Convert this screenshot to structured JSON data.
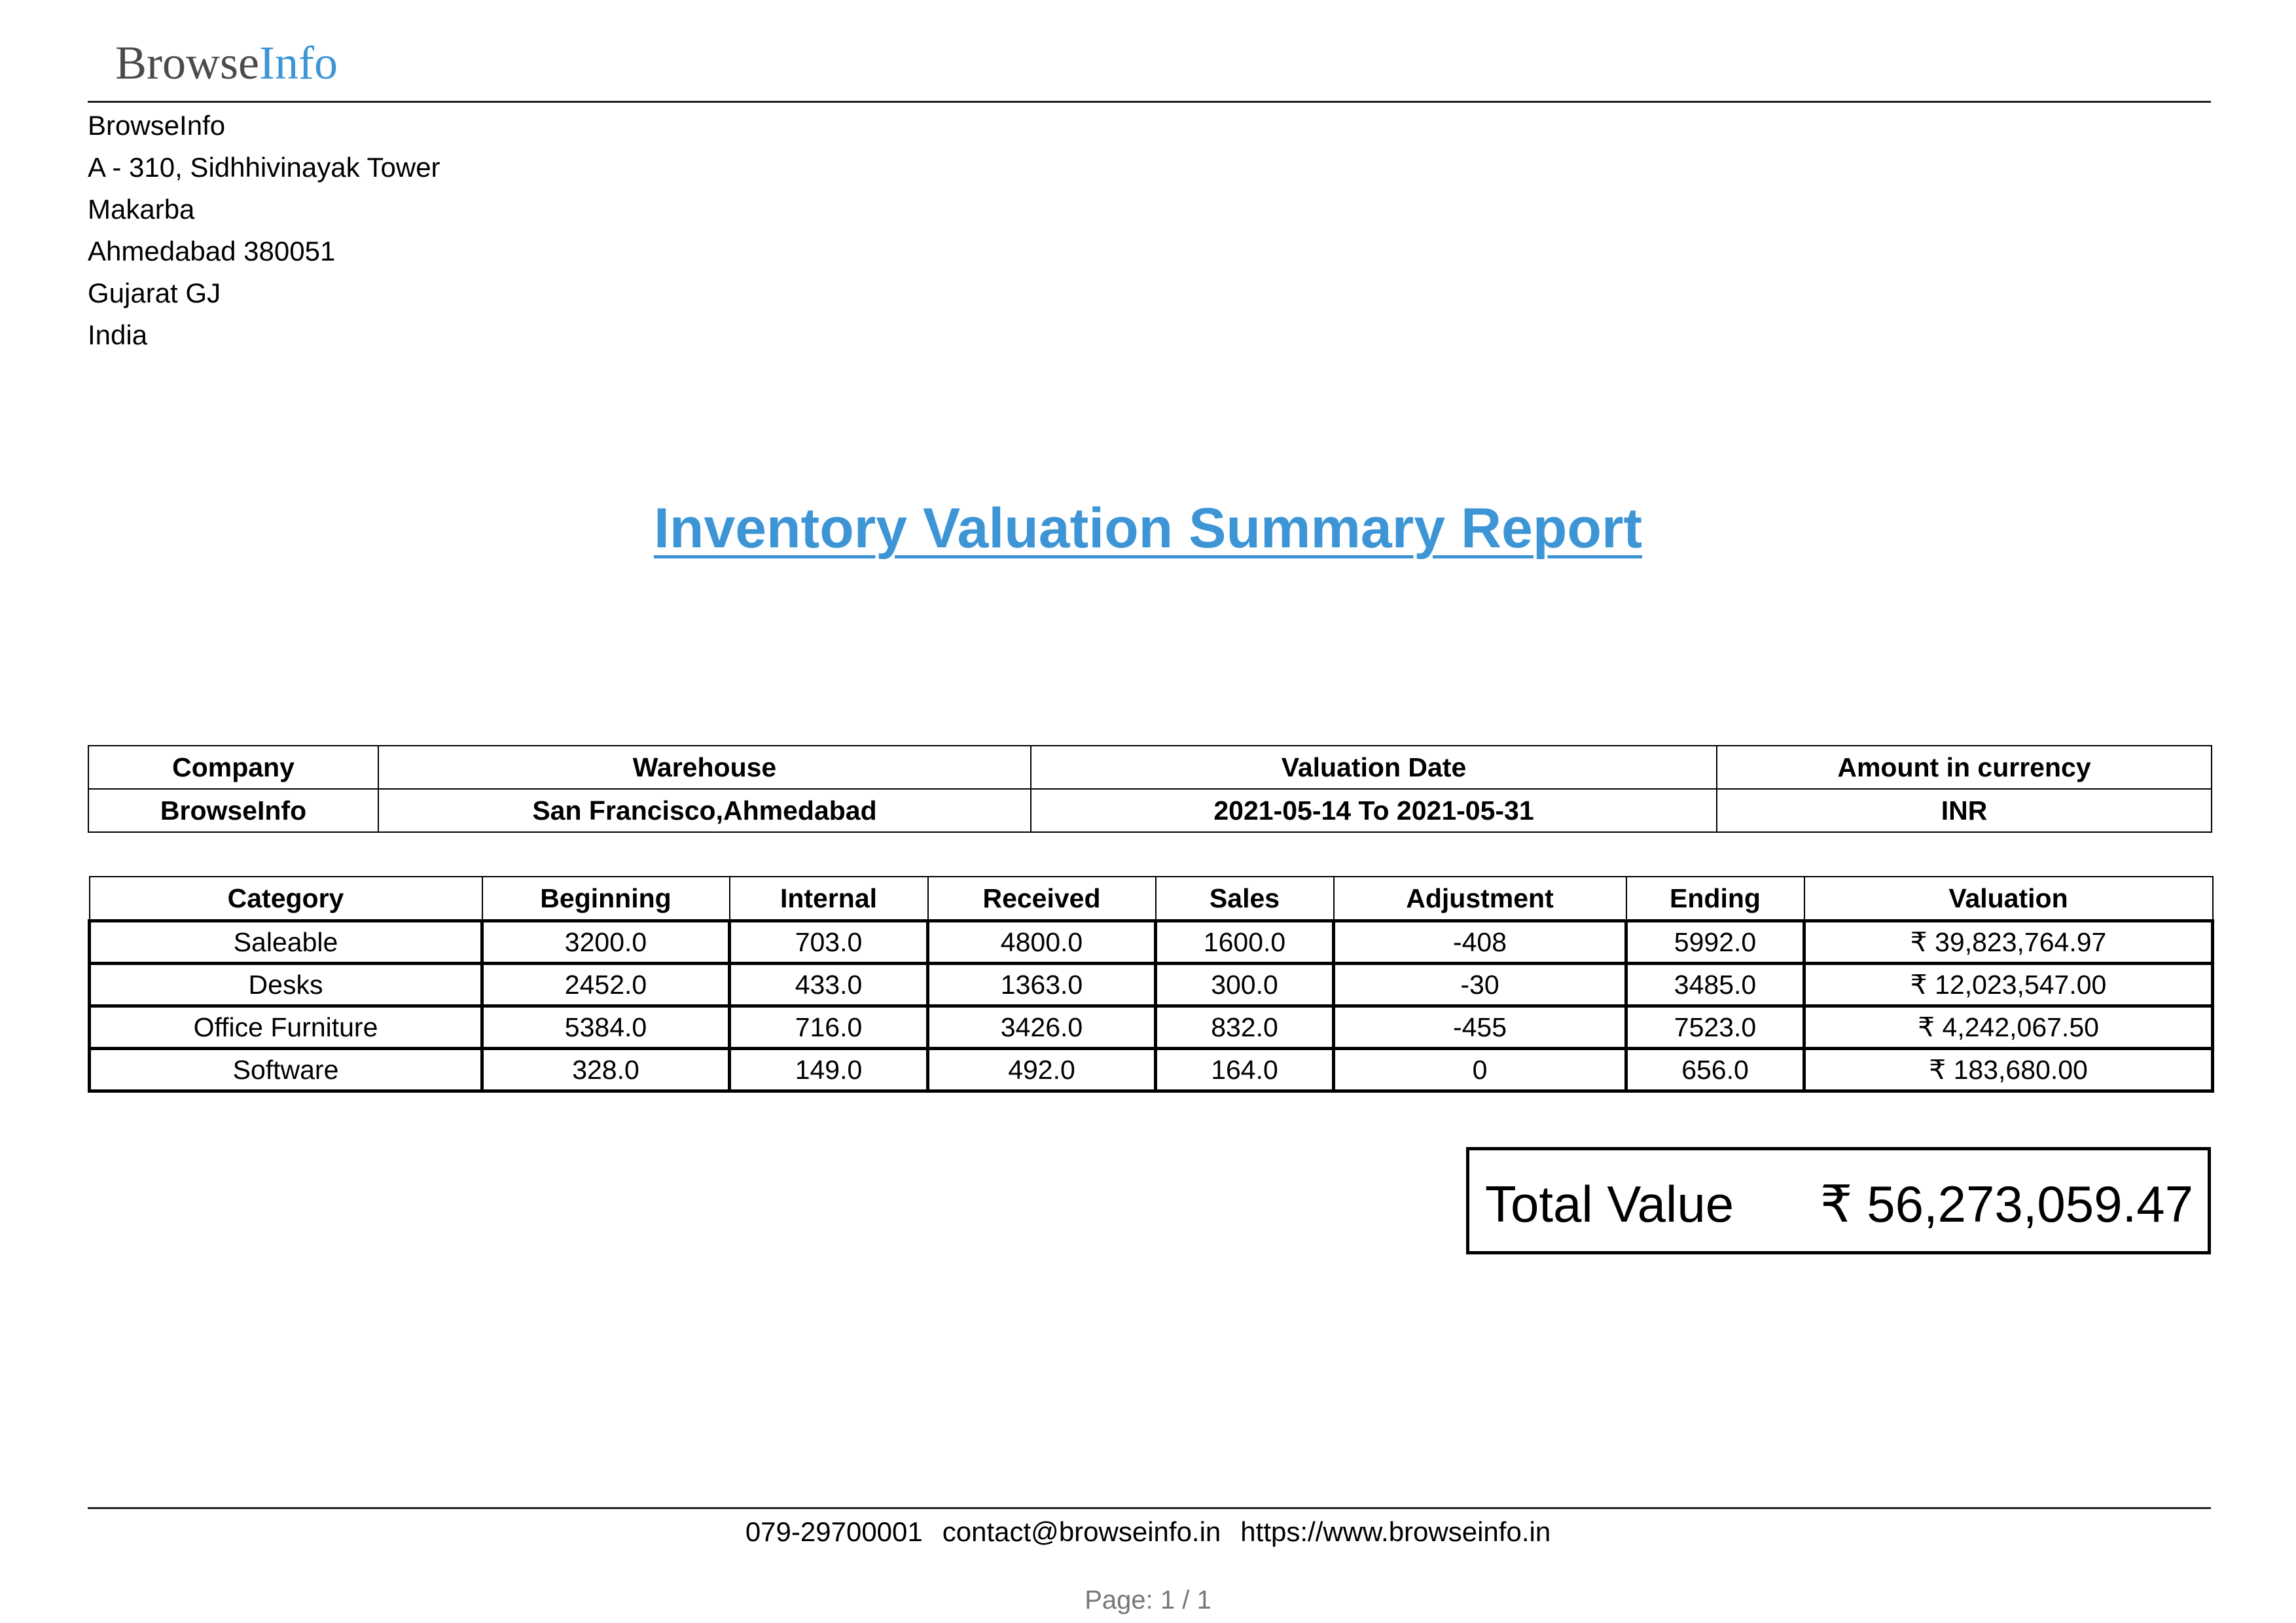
{
  "logo": {
    "part1": "Browse",
    "part2": "Info"
  },
  "address": [
    "BrowseInfo",
    "A - 310, Sidhhivinayak Tower",
    "Makarba",
    "Ahmedabad 380051",
    "Gujarat GJ",
    "India"
  ],
  "title": "Inventory Valuation Summary Report",
  "info_table": {
    "headers": [
      "Company",
      "Warehouse",
      "Valuation Date",
      "Amount in currency"
    ],
    "values": [
      "BrowseInfo",
      "San Francisco,Ahmedabad",
      "2021-05-14 To 2021-05-31",
      "INR"
    ]
  },
  "category_table": {
    "headers": [
      "Category",
      "Beginning",
      "Internal",
      "Received",
      "Sales",
      "Adjustment",
      "Ending",
      "Valuation"
    ],
    "rows": [
      [
        "Saleable",
        "3200.0",
        "703.0",
        "4800.0",
        "1600.0",
        "-408",
        "5992.0",
        "₹ 39,823,764.97"
      ],
      [
        "Desks",
        "2452.0",
        "433.0",
        "1363.0",
        "300.0",
        "-30",
        "3485.0",
        "₹ 12,023,547.00"
      ],
      [
        "Office Furniture",
        "5384.0",
        "716.0",
        "3426.0",
        "832.0",
        "-455",
        "7523.0",
        "₹ 4,242,067.50"
      ],
      [
        "Software",
        "328.0",
        "149.0",
        "492.0",
        "164.0",
        "0",
        "656.0",
        "₹ 183,680.00"
      ]
    ]
  },
  "total": {
    "label": "Total Value",
    "value": "₹ 56,273,059.47"
  },
  "footer": {
    "phone": "079-29700001",
    "email": "contact@browseinfo.in",
    "website": "https://www.browseinfo.in",
    "page": "Page: 1 / 1"
  }
}
